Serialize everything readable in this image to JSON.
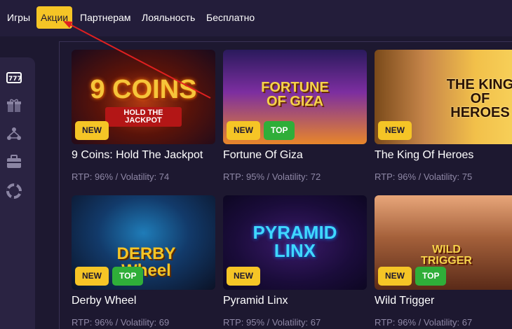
{
  "nav": {
    "items": [
      {
        "label": "Игры",
        "active": false
      },
      {
        "label": "Акции",
        "active": true
      },
      {
        "label": "Партнерам",
        "active": false
      },
      {
        "label": "Лояльность",
        "active": false
      },
      {
        "label": "Бесплатно",
        "active": false
      }
    ]
  },
  "sidebar": {
    "icons": [
      "slot-machine-icon",
      "gift-icon",
      "tournament-icon",
      "briefcase-icon",
      "lifebuoy-icon"
    ]
  },
  "colors": {
    "accent": "#f5c526",
    "top_badge": "#2fae39",
    "background": "#1d1830",
    "annotation_arrow": "#e02020"
  },
  "games": [
    {
      "thumb_text": "9 COINS",
      "thumb_subtext": "HOLD THE JACKPOT",
      "title": "9 Coins: Hold The Jackpot",
      "meta": "RTP: 96% / Volatility: 74",
      "badges": [
        "NEW"
      ]
    },
    {
      "thumb_text": "FORTUNE OF GIZA",
      "thumb_subtext": "",
      "title": "Fortune Of Giza",
      "meta": "RTP: 95% / Volatility: 72",
      "badges": [
        "NEW",
        "TOP"
      ]
    },
    {
      "thumb_text": "THE KING OF HEROES",
      "thumb_subtext": "",
      "title": "The King Of Heroes",
      "meta": "RTP: 96% / Volatility: 75",
      "badges": [
        "NEW"
      ]
    },
    {
      "thumb_text": "DERBY Wheel",
      "thumb_subtext": "",
      "title": "Derby Wheel",
      "meta": "RTP: 96% / Volatility: 69",
      "badges": [
        "NEW",
        "TOP"
      ]
    },
    {
      "thumb_text": "PYRAMID LINX",
      "thumb_subtext": "",
      "title": "Pyramid Linx",
      "meta": "RTP: 95% / Volatility: 67",
      "badges": [
        "NEW"
      ]
    },
    {
      "thumb_text": "WILD TRIGGER",
      "thumb_subtext": "",
      "title": "Wild Trigger",
      "meta": "RTP: 96% / Volatility: 67",
      "badges": [
        "NEW",
        "TOP"
      ]
    }
  ]
}
